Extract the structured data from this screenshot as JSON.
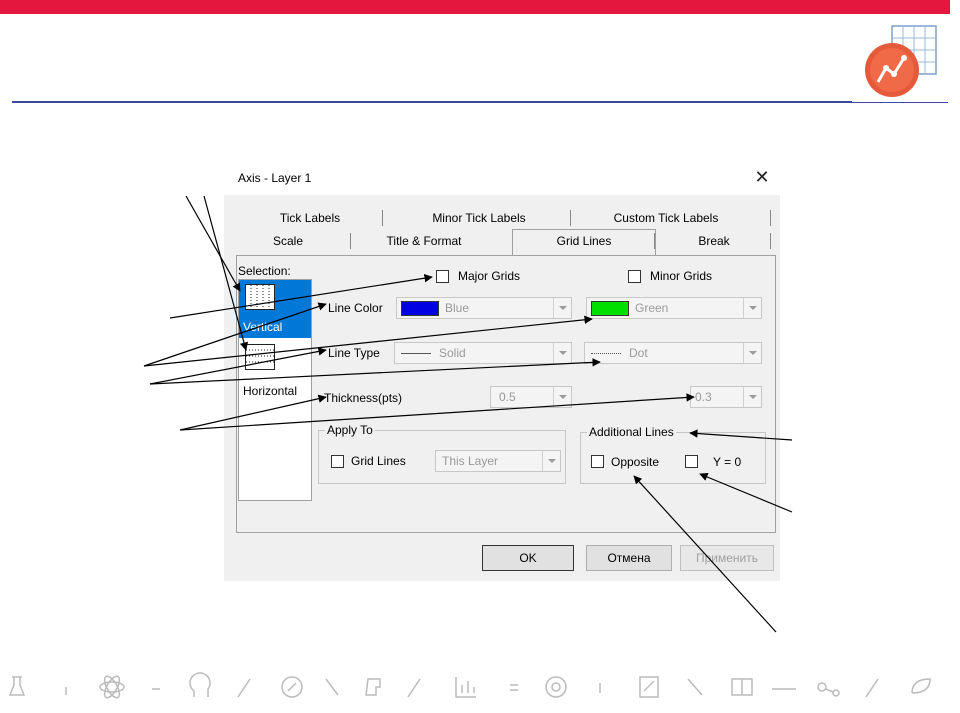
{
  "slide": {
    "brand_color": "#e4173e",
    "line_color": "#3b4aa0"
  },
  "dialog": {
    "title": "Axis - Layer 1",
    "close_icon": "close-icon",
    "tabs_row1": [
      "Tick Labels",
      "Minor Tick Labels",
      "Custom Tick Labels"
    ],
    "tabs_row2": [
      "Scale",
      "Title & Format",
      "Grid Lines",
      "Break"
    ],
    "active_tab": "Grid Lines",
    "selection_label": "Selection:",
    "selection_items": [
      "Vertical",
      "Horizontal"
    ],
    "selected_item": "Vertical",
    "major_grids_label": "Major Grids",
    "minor_grids_label": "Minor Grids",
    "line_color_label": "Line Color",
    "line_type_label": "Line Type",
    "thickness_label": "Thickness(pts)",
    "major": {
      "color_name": "Blue",
      "color_hex": "#0000e0",
      "type": "Solid",
      "thickness": "0.5"
    },
    "minor": {
      "color_name": "Green",
      "color_hex": "#00e000",
      "type": "Dot",
      "thickness": "0.3"
    },
    "apply_to": {
      "legend": "Apply To",
      "grid_lines_label": "Grid Lines",
      "layer_value": "This Layer"
    },
    "additional_lines": {
      "legend": "Additional Lines",
      "opposite_label": "Opposite",
      "y0_label": "Y = 0"
    },
    "buttons": {
      "ok": "OK",
      "cancel": "Отмена",
      "apply": "Применить"
    }
  }
}
